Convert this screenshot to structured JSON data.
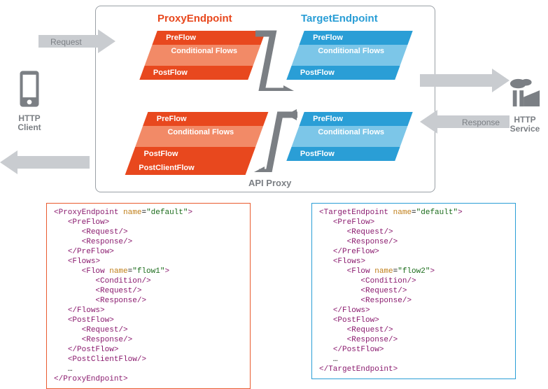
{
  "headers": {
    "proxy": "ProxyEndpoint",
    "target": "TargetEndpoint"
  },
  "apiBoxLabel": "API Proxy",
  "client": {
    "line1": "HTTP",
    "line2": "Client"
  },
  "service": {
    "line1": "HTTP",
    "line2": "Service"
  },
  "arrowLabels": {
    "request": "Request",
    "response": "Response"
  },
  "flowStages": {
    "preflow": "PreFlow",
    "conditional": "Conditional\nFlows",
    "postflow": "PostFlow",
    "postclient": "PostClientFlow"
  },
  "xml": {
    "proxy": {
      "rootOpen": "ProxyEndpoint",
      "rootAttr": "name",
      "rootVal": "\"default\"",
      "preflow": "PreFlow",
      "request": "Request",
      "response": "Response",
      "flows": "Flows",
      "flow": "Flow",
      "flowAttr": "name",
      "flowVal": "\"flow1\"",
      "condition": "Condition",
      "postflow": "PostFlow",
      "postclient": "PostClientFlow",
      "ellipsis": "…",
      "close": "ProxyEndpoint"
    },
    "target": {
      "rootOpen": "TargetEndpoint",
      "rootAttr": "name",
      "rootVal": "\"default\"",
      "preflow": "PreFlow",
      "request": "Request",
      "response": "Response",
      "flows": "Flows",
      "flow": "Flow",
      "flowAttr": "name",
      "flowVal": "\"flow2\"",
      "condition": "Condition",
      "postflow": "PostFlow",
      "ellipsis": "…",
      "close": "TargetEndpoint"
    }
  }
}
